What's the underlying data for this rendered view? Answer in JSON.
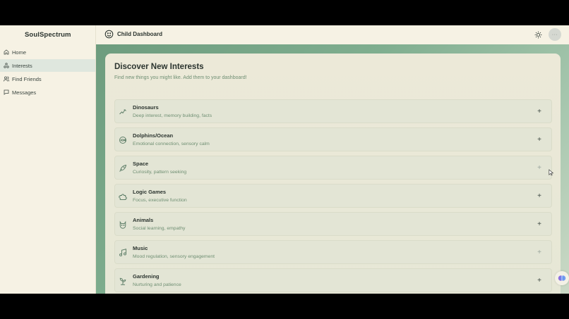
{
  "app": {
    "brand": "SoulSpectrum",
    "header_title": "Child Dashboard",
    "avatar_text": "···"
  },
  "sidebar": {
    "items": [
      {
        "label": "Home",
        "icon": "home-icon",
        "active": false
      },
      {
        "label": "Interests",
        "icon": "interests-icon",
        "active": true
      },
      {
        "label": "Find Friends",
        "icon": "users-icon",
        "active": false
      },
      {
        "label": "Messages",
        "icon": "message-icon",
        "active": false
      }
    ]
  },
  "main": {
    "title": "Discover New Interests",
    "subtitle": "Find new things you might like. Add them to your dashboard!",
    "interests": [
      {
        "title": "Dinosaurs",
        "desc": "Deep interest, memory building, facts",
        "icon": "dinosaur-icon"
      },
      {
        "title": "Dolphins/Ocean",
        "desc": "Emotional connection, sensory calm",
        "icon": "fish-icon"
      },
      {
        "title": "Space",
        "desc": "Curiosity, pattern seeking",
        "icon": "rocket-icon"
      },
      {
        "title": "Logic Games",
        "desc": "Focus, executive function",
        "icon": "puzzle-icon"
      },
      {
        "title": "Animals",
        "desc": "Social learning, empathy",
        "icon": "cat-icon"
      },
      {
        "title": "Music",
        "desc": "Mood regulation, sensory engagement",
        "icon": "music-icon"
      },
      {
        "title": "Gardening",
        "desc": "Nurturing and patience",
        "icon": "sprout-icon"
      }
    ],
    "add_label": "+"
  },
  "colors": {
    "accent": "#6d9c7e",
    "sidebar_active": "#dfe7de",
    "subtle_text": "#6f8f73"
  }
}
